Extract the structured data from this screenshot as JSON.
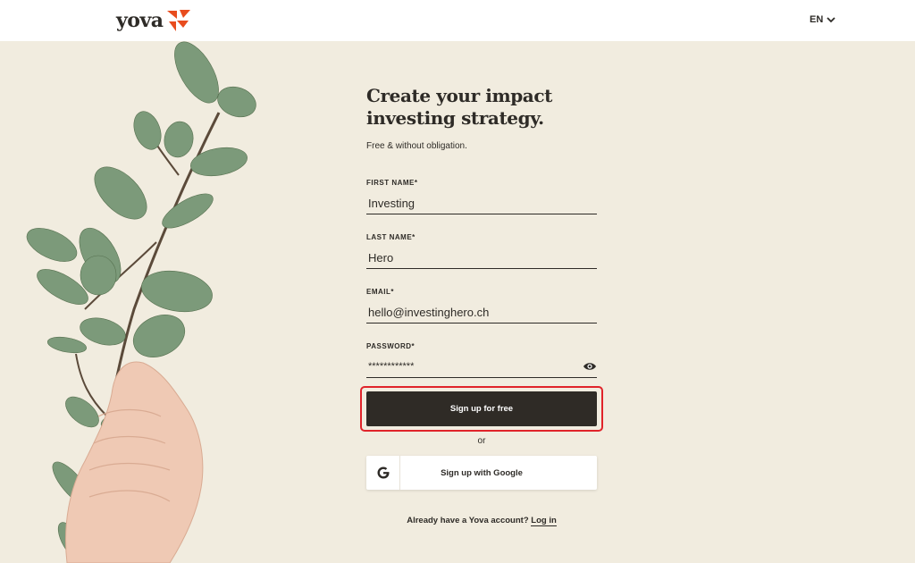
{
  "header": {
    "logo_text": "yova",
    "language": "EN",
    "brand_color": "#e84c1e"
  },
  "form": {
    "title_line1": "Create your impact",
    "title_line2": "investing strategy.",
    "subtitle": "Free & without obligation.",
    "first_name": {
      "label": "FIRST NAME*",
      "value": "Investing"
    },
    "last_name": {
      "label": "LAST NAME*",
      "value": "Hero"
    },
    "email": {
      "label": "EMAIL*",
      "value": "hello@investinghero.ch"
    },
    "password": {
      "label": "PASSWORD*",
      "value": "************"
    },
    "signup_label": "Sign up for free",
    "or_label": "or",
    "google_label": "Sign up with Google",
    "login_prompt": "Already have a Yova account?",
    "login_link": "Log in"
  },
  "icons": {
    "language": "chevron-down-icon",
    "password_toggle": "eye-icon",
    "google": "google-icon"
  },
  "colors": {
    "background": "#f1ecdf",
    "button": "#2f2b26",
    "highlight": "#e0232a"
  }
}
